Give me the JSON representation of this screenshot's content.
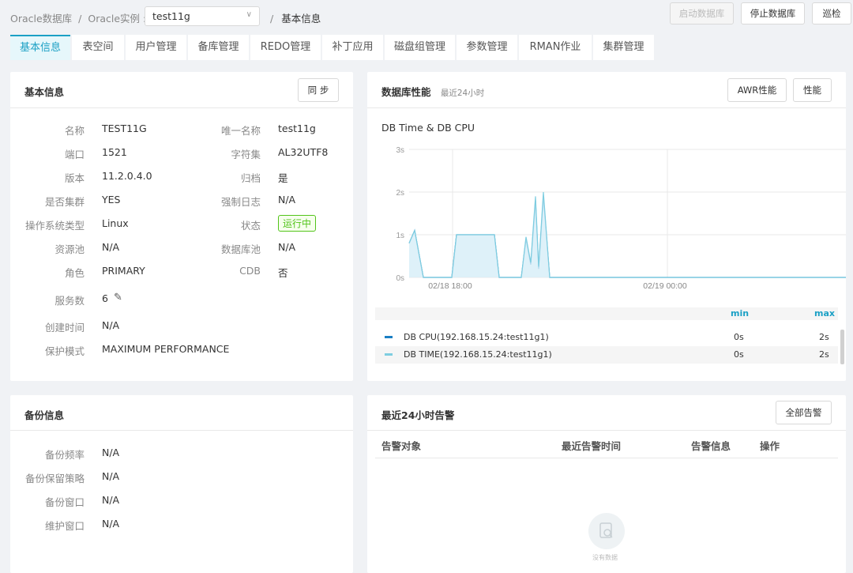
{
  "breadcrumb": {
    "db": "Oracle数据库",
    "sep1": "/",
    "inst_label": "Oracle实例 :",
    "sep2": "/",
    "current": "基本信息"
  },
  "instance_select": {
    "value": "test11g",
    "chevron": "chevron-down-icon"
  },
  "actions": {
    "start": "启动数据库",
    "stop": "停止数据库",
    "inspect": "巡检"
  },
  "tabs": [
    "基本信息",
    "表空间",
    "用户管理",
    "备库管理",
    "REDO管理",
    "补丁应用",
    "磁盘组管理",
    "参数管理",
    "RMAN作业",
    "集群管理"
  ],
  "basic": {
    "title": "基本信息",
    "sync": "同 步",
    "left": [
      [
        "名称",
        "TEST11G"
      ],
      [
        "端口",
        "1521"
      ],
      [
        "版本",
        "11.2.0.4.0"
      ],
      [
        "是否集群",
        "YES"
      ],
      [
        "操作系统类型",
        "Linux"
      ],
      [
        "资源池",
        "N/A"
      ],
      [
        "角色",
        "PRIMARY"
      ]
    ],
    "right": [
      [
        "唯一名称",
        "test11g"
      ],
      [
        "字符集",
        "AL32UTF8"
      ],
      [
        "归档",
        "是"
      ],
      [
        "强制日志",
        "N/A"
      ],
      [
        "状态",
        "运行中"
      ],
      [
        "数据库池",
        "N/A"
      ],
      [
        "CDB",
        "否"
      ]
    ],
    "services_label": "服务数",
    "services_value": "6",
    "created_label": "创建时间",
    "created_value": "N/A",
    "protect_label": "保护模式",
    "protect_value": "MAXIMUM PERFORMANCE"
  },
  "perf": {
    "title": "数据库性能",
    "subtitle": "最近24小时",
    "awr": "AWR性能",
    "perf": "性能",
    "chart_title": "DB Time & DB CPU",
    "legend_header": {
      "min": "min",
      "max": "max"
    },
    "legend": [
      {
        "name": "DB CPU(192.168.15.24:test11g1)",
        "min": "0s",
        "max": "2s",
        "color": "#1a7fc4"
      },
      {
        "name": "DB TIME(192.168.15.24:test11g1)",
        "min": "0s",
        "max": "2s",
        "color": "#7ecde0"
      }
    ]
  },
  "chart_data": {
    "type": "area",
    "title": "DB Time & DB CPU",
    "y_ticks": [
      "3s",
      "2s",
      "1s",
      "0s"
    ],
    "ylim": [
      0,
      3
    ],
    "x_ticks": [
      "02/18 18:00",
      "02/19 00:00"
    ],
    "series": [
      {
        "name": "DB CPU(192.168.15.24:test11g1)",
        "points": [
          [
            0,
            0.8
          ],
          [
            0.35,
            1.1
          ],
          [
            0.9,
            0
          ],
          [
            2.7,
            0
          ],
          [
            3.0,
            1.0
          ],
          [
            5.4,
            1.0
          ],
          [
            5.7,
            0
          ],
          [
            7.1,
            0
          ],
          [
            7.4,
            0.9
          ],
          [
            7.7,
            0.3
          ],
          [
            8.0,
            1.8
          ],
          [
            8.2,
            0.2
          ],
          [
            8.5,
            1.9
          ],
          [
            8.9,
            0
          ],
          [
            28,
            0
          ]
        ]
      },
      {
        "name": "DB TIME(192.168.15.24:test11g1)",
        "points": [
          [
            0,
            0.8
          ],
          [
            0.35,
            1.1
          ],
          [
            0.9,
            0
          ],
          [
            2.7,
            0
          ],
          [
            3.0,
            1.0
          ],
          [
            5.4,
            1.0
          ],
          [
            5.7,
            0
          ],
          [
            7.1,
            0
          ],
          [
            7.4,
            0.95
          ],
          [
            7.7,
            0.35
          ],
          [
            8.0,
            1.9
          ],
          [
            8.2,
            0.25
          ],
          [
            8.5,
            2.0
          ],
          [
            8.9,
            0
          ],
          [
            28,
            0
          ]
        ]
      }
    ],
    "colors": {
      "cpu": "#1a7fc4",
      "time": "#7ecde0",
      "fill": "#d6eef7"
    }
  },
  "backup": {
    "title": "备份信息",
    "rows": [
      [
        "备份频率",
        "N/A"
      ],
      [
        "备份保留策略",
        "N/A"
      ],
      [
        "备份窗口",
        "N/A"
      ],
      [
        "维护窗口",
        "N/A"
      ]
    ]
  },
  "alerts": {
    "title": "最近24小时告警",
    "all": "全部告警",
    "columns": [
      "告警对象",
      "最近告警时间",
      "告警信息",
      "操作"
    ],
    "empty": "没有数据",
    "empty_icon": "no-data-icon"
  }
}
